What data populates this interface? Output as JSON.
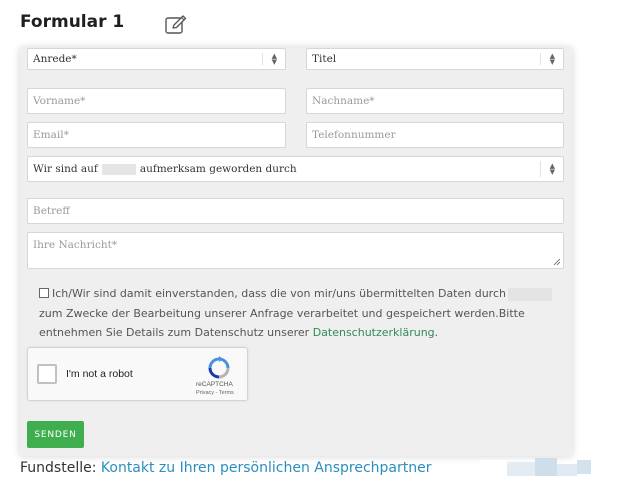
{
  "header": {
    "title": "Formular 1",
    "edit_icon": "edit-icon"
  },
  "form": {
    "salutation": {
      "value": "Anrede*"
    },
    "title_select": {
      "value": "Titel"
    },
    "first_name": {
      "placeholder": "Vorname*"
    },
    "last_name": {
      "placeholder": "Nachname*"
    },
    "email": {
      "placeholder": "Email*"
    },
    "phone": {
      "placeholder": "Telefonnummer"
    },
    "source_select": {
      "prefix": "Wir sind auf",
      "suffix": "aufmerksam geworden durch"
    },
    "subject": {
      "placeholder": "Betreff"
    },
    "message": {
      "placeholder": "Ihre Nachricht*"
    },
    "consent": {
      "text_part1": "Ich/Wir sind damit einverstanden, dass die von mir/uns übermittelten Daten durch",
      "text_part2": "zum Zwecke der Bearbeitung unserer Anfrage verarbeitet und gespeichert werden.Bitte entnehmen Sie Details zum Datenschutz unserer",
      "link": "Datenschutzerklärung",
      "end": "."
    },
    "captcha": {
      "label": "I'm not a robot",
      "brand": "reCAPTCHA",
      "privacy": "Privacy",
      "terms": "Terms",
      "separator": " - "
    },
    "submit_label": "SENDEN"
  },
  "footer": {
    "label": "Fundstelle:",
    "link": "Kontakt zu Ihren persönlichen Ansprechpartner"
  },
  "colors": {
    "accent_green": "#3fae4e",
    "link_blue": "#2a8ec0",
    "link_green": "#2e8b57"
  }
}
